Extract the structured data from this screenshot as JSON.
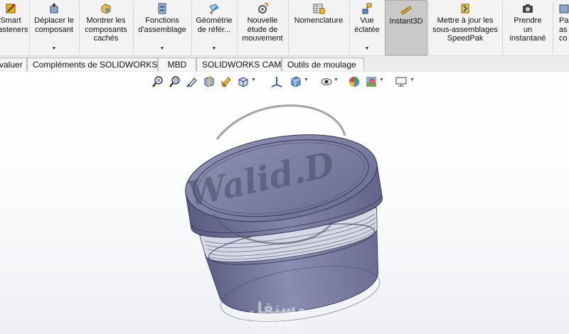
{
  "ribbon": {
    "buttons": [
      {
        "label": "Smart\nFasteners",
        "icon": "smart-fasteners-icon"
      },
      {
        "label": "Déplacer le\ncomposant",
        "icon": "move-component-icon"
      },
      {
        "label": "Montrer les\ncomposants\ncachés",
        "icon": "show-hidden-components-icon"
      },
      {
        "label": "Fonctions\nd'assemblage",
        "icon": "assembly-features-icon"
      },
      {
        "label": "Géométrie\nde référ...",
        "icon": "reference-geometry-icon"
      },
      {
        "label": "Nouvelle\nétude de\nmouvement",
        "icon": "new-motion-study-icon"
      },
      {
        "label": "Nomenclature",
        "icon": "bill-of-materials-icon"
      },
      {
        "label": "Vue\néclatée",
        "icon": "exploded-view-icon"
      },
      {
        "label": "Instant3D",
        "icon": "instant3d-icon"
      },
      {
        "label": "Mettre à jour les\nsous-assemblages\nSpeedPak",
        "icon": "speedpak-icon"
      },
      {
        "label": "Prendre\nun\ninstantané",
        "icon": "snapshot-camera-icon"
      },
      {
        "label": "Pa\nas\nco",
        "icon": "large-assembly-icon"
      }
    ]
  },
  "tabs": [
    "valuer",
    "Compléments de SOLIDWORKS",
    "MBD",
    "SOLIDWORKS CAM",
    "Outils de moulage"
  ],
  "watermark": {
    "signature": "Walid.D",
    "brand_text": "mostaql.com"
  },
  "colors": {
    "part": "#7a7ca0",
    "accent": "#2f7cc4"
  }
}
